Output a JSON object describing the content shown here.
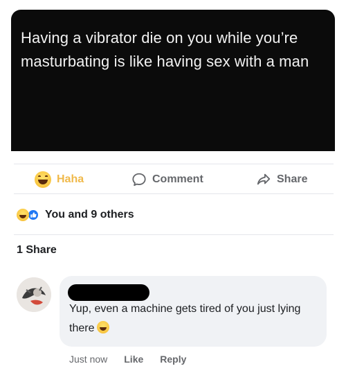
{
  "post": {
    "text": "Having a vibrator die on you while you’re masturbating is like having sex with a man"
  },
  "actions": {
    "haha_label": "Haha",
    "comment_label": "Comment",
    "share_label": "Share",
    "haha_color": "#f0b94a"
  },
  "reactions": {
    "summary": "You and 9 others",
    "icons": [
      "haha-icon",
      "like-icon"
    ]
  },
  "share_count": "1 Share",
  "comment": {
    "text": "Yup, even a machine gets tired of you just lying there",
    "emoji": "haha-icon",
    "meta": {
      "time": "Just now",
      "like_label": "Like",
      "reply_label": "Reply"
    }
  }
}
